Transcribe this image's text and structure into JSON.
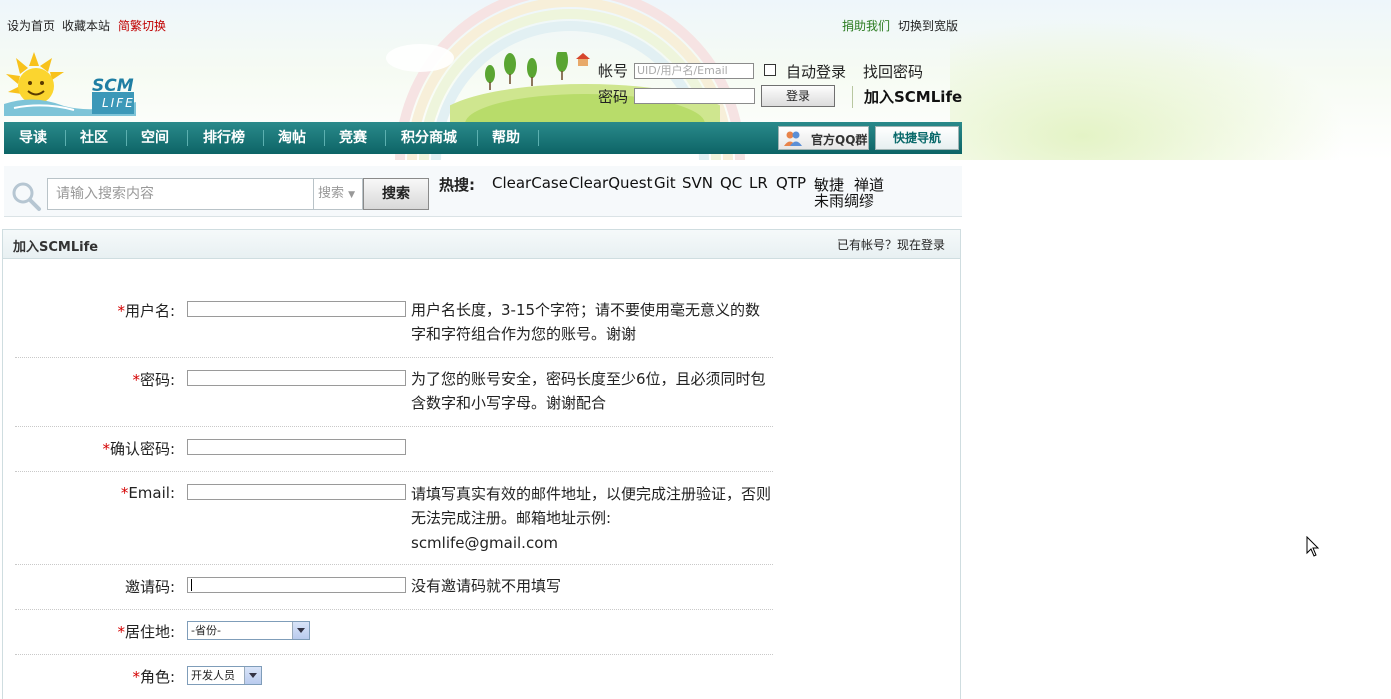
{
  "top_links": {
    "set_home": "设为首页",
    "bookmark": "收藏本站",
    "trad_simp": "简繁切换",
    "donate": "捐助我们",
    "wide": "切换到宽版"
  },
  "logo": {
    "text_top": "SCM",
    "text_bottom": "LIFE"
  },
  "login": {
    "account_label": "帐号",
    "account_placeholder": "UID/用户名/Email",
    "password_label": "密码",
    "auto_login": "自动登录",
    "forgot": "找回密码",
    "login_button": "登录",
    "join": "加入SCMLife"
  },
  "nav": {
    "items": [
      "导读",
      "社区",
      "空间",
      "排行榜",
      "淘帖",
      "竞赛",
      "积分商城",
      "帮助"
    ],
    "qq_group": "官方QQ群",
    "quick_nav": "快捷导航"
  },
  "search": {
    "placeholder": "请输入搜索内容",
    "scope": "搜索",
    "button": "搜索",
    "hot_label": "热搜:",
    "hot_terms": [
      "ClearCase",
      "ClearQuest",
      "Git",
      "SVN",
      "QC",
      "LR",
      "QTP",
      "敏捷",
      "禅道",
      "未雨绸缪"
    ]
  },
  "panel": {
    "title": "加入SCMLife",
    "login_link": "已有帐号？现在登录"
  },
  "form": {
    "username": {
      "label": "用户名:",
      "hint": "用户名长度，3-15个字符；请不要使用毫无意义的数字和字符组合作为您的账号。谢谢"
    },
    "password": {
      "label": "密码:",
      "hint": "为了您的账号安全，密码长度至少6位，且必须同时包含数字和小写字母。谢谢配合"
    },
    "confirm": {
      "label": "确认密码:"
    },
    "email": {
      "label": "Email:",
      "hint": "请填写真实有效的邮件地址，以便完成注册验证，否则无法完成注册。邮箱地址示例:",
      "example": "scmlife@gmail.com"
    },
    "invite": {
      "label": "邀请码:",
      "hint": "没有邀请码就不用填写"
    },
    "residence": {
      "label": "居住地:",
      "value": "-省份-"
    },
    "role": {
      "label": "角色:",
      "value": "开发人员"
    },
    "required_mark": "*"
  },
  "colors": {
    "nav": "#13706f",
    "required": "#d40000",
    "donate": "#2a7b1f",
    "trad": "#c00000"
  }
}
